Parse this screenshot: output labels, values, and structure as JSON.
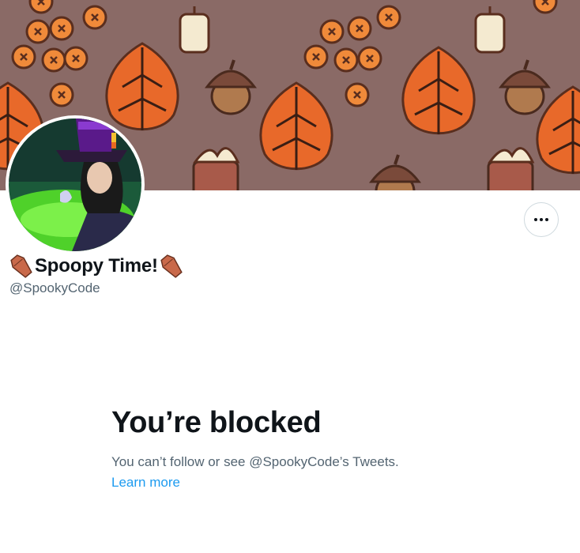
{
  "profile": {
    "display_name": "Spoopy Time!",
    "handle": "@SpookyCode",
    "name_emoji_left": "coffin-icon",
    "name_emoji_right": "coffin-icon"
  },
  "header": {
    "more_button_icon": "more-horizontal-icon"
  },
  "blocked": {
    "title": "You’re blocked",
    "message": "You can’t follow or see @SpookyCode’s Tweets.",
    "learn_more": "Learn more"
  },
  "colors": {
    "banner_bg": "#8a6a66",
    "link": "#1d9bf0",
    "text_primary": "#0f1419",
    "text_secondary": "#536471"
  }
}
